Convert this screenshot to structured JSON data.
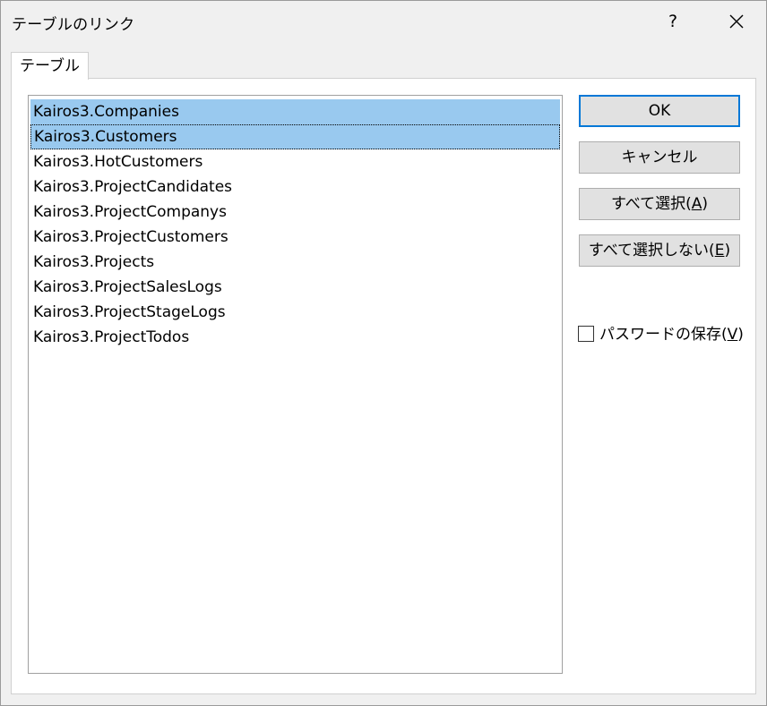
{
  "window": {
    "title": "テーブルのリンク",
    "help_label": "?",
    "close_icon": "close-icon"
  },
  "tabs": [
    {
      "label": "テーブル",
      "active": true
    }
  ],
  "table_list": {
    "items": [
      {
        "label": "Kairos3.Companies",
        "selected": true
      },
      {
        "label": "Kairos3.Customers",
        "selected": true,
        "focused": true
      },
      {
        "label": "Kairos3.HotCustomers",
        "selected": false
      },
      {
        "label": "Kairos3.ProjectCandidates",
        "selected": false
      },
      {
        "label": "Kairos3.ProjectCompanys",
        "selected": false
      },
      {
        "label": "Kairos3.ProjectCustomers",
        "selected": false
      },
      {
        "label": "Kairos3.Projects",
        "selected": false
      },
      {
        "label": "Kairos3.ProjectSalesLogs",
        "selected": false
      },
      {
        "label": "Kairos3.ProjectStageLogs",
        "selected": false
      },
      {
        "label": "Kairos3.ProjectTodos",
        "selected": false
      }
    ]
  },
  "buttons": {
    "ok": "OK",
    "cancel": "キャンセル",
    "select_all_text": "すべて選択(",
    "select_all_key": "A",
    "select_all_end": ")",
    "deselect_all_text": "すべて選択しない(",
    "deselect_all_key": "E",
    "deselect_all_end": ")"
  },
  "save_password": {
    "text": "パスワードの保存(",
    "key": "V",
    "end": ")",
    "checked": false
  },
  "colors": {
    "selection": "#99c9ef",
    "default_button_border": "#0078d7",
    "dialog_background": "#f0f0f0"
  }
}
